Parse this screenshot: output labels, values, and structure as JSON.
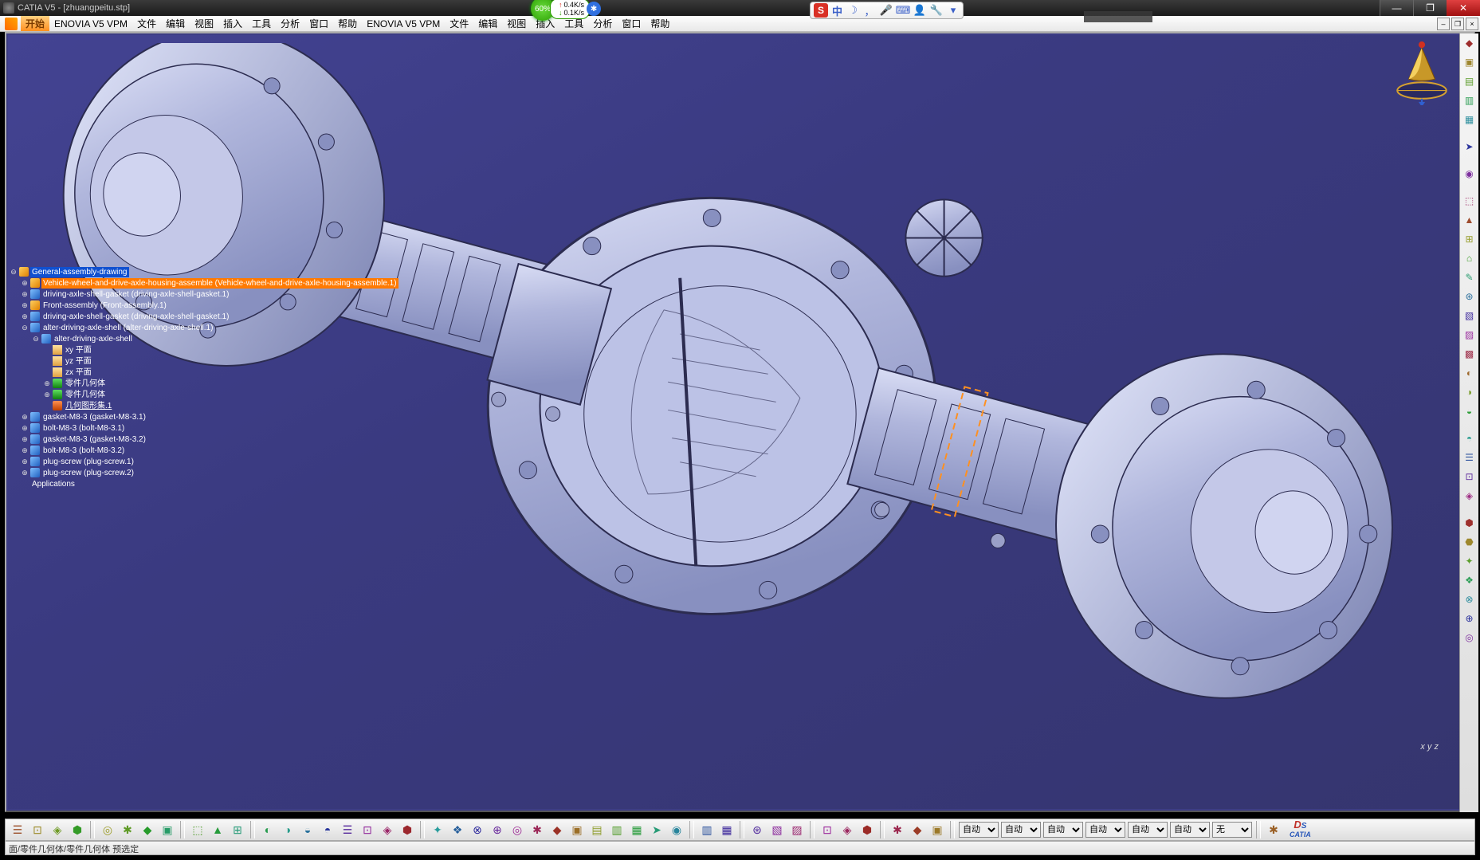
{
  "window": {
    "title": "CATIA V5 - [zhuangpeitu.stp]"
  },
  "menu": {
    "start": "开始",
    "items": [
      "ENOVIA V5 VPM",
      "文件",
      "编辑",
      "视图",
      "插入",
      "工具",
      "分析",
      "窗口",
      "帮助"
    ]
  },
  "overlay": {
    "percent": "60%",
    "up_speed": "0.4K/s",
    "down_speed": "0.1K/s"
  },
  "ime": {
    "logo": "S",
    "mode": "中",
    "icons": [
      "moon",
      "comma",
      "mic",
      "keyboard",
      "person",
      "wrench",
      "gear"
    ]
  },
  "tree": [
    {
      "depth": 0,
      "exp": "-",
      "ico": "assy",
      "label": "General-assembly-drawing",
      "sel": "blue"
    },
    {
      "depth": 1,
      "exp": "+",
      "ico": "assy",
      "label": "Vehicle-wheel-and-drive-axle-housing-assemble (Vehicle-wheel-and-drive-axle-housing-assemble.1)",
      "sel": "orange"
    },
    {
      "depth": 1,
      "exp": "+",
      "ico": "part",
      "label": "driving-axle-shell-gasket (driving-axle-shell-gasket.1)"
    },
    {
      "depth": 1,
      "exp": "+",
      "ico": "assy",
      "label": "Front-assembly (Front-assembly.1)"
    },
    {
      "depth": 1,
      "exp": "+",
      "ico": "part",
      "label": "driving-axle-shell-gasket (driving-axle-shell-gasket.1)"
    },
    {
      "depth": 1,
      "exp": "-",
      "ico": "part",
      "label": "alter-driving-axle-shell (alter-driving-axle-shell.1)"
    },
    {
      "depth": 2,
      "exp": "-",
      "ico": "part",
      "label": "alter-driving-axle-shell"
    },
    {
      "depth": 3,
      "exp": "",
      "ico": "plane",
      "label": "xy 平面"
    },
    {
      "depth": 3,
      "exp": "",
      "ico": "plane",
      "label": "yz 平面"
    },
    {
      "depth": 3,
      "exp": "",
      "ico": "plane",
      "label": "zx 平面"
    },
    {
      "depth": 3,
      "exp": "+",
      "ico": "body",
      "label": "零件几何体"
    },
    {
      "depth": 3,
      "exp": "+",
      "ico": "body",
      "label": "零件几何体"
    },
    {
      "depth": 3,
      "exp": "",
      "ico": "cons",
      "label": "几何图形集.1",
      "ul": true
    },
    {
      "depth": 1,
      "exp": "+",
      "ico": "part",
      "label": "gasket-M8-3 (gasket-M8-3.1)"
    },
    {
      "depth": 1,
      "exp": "+",
      "ico": "part",
      "label": "bolt-M8-3 (bolt-M8-3.1)"
    },
    {
      "depth": 1,
      "exp": "+",
      "ico": "part",
      "label": "gasket-M8-3 (gasket-M8-3.2)"
    },
    {
      "depth": 1,
      "exp": "+",
      "ico": "part",
      "label": "bolt-M8-3 (bolt-M8-3.2)"
    },
    {
      "depth": 1,
      "exp": "+",
      "ico": "part",
      "label": "plug-screw (plug-screw.1)"
    },
    {
      "depth": 1,
      "exp": "+",
      "ico": "part",
      "label": "plug-screw (plug-screw.2)"
    },
    {
      "depth": 0,
      "exp": "",
      "ico": "",
      "label": "Applications"
    }
  ],
  "right_toolbar_groups": [
    [
      "tool1",
      "tool2",
      "tool3",
      "tool4",
      "tool5"
    ],
    [
      "arrow"
    ],
    [
      "tool6"
    ],
    [
      "tool7",
      "tool8",
      "tool9",
      "tool10",
      "tool11",
      "tool12",
      "tool13",
      "tool14",
      "tool15",
      "tool16",
      "tool17",
      "tool18"
    ],
    [
      "tool19",
      "tool20",
      "tool21",
      "tool22"
    ],
    [
      "tool23",
      "tool24",
      "tool25",
      "tool26",
      "tool27",
      "tool28",
      "tool29"
    ]
  ],
  "bottom_toolbar": {
    "icons_left": [
      "new",
      "open",
      "save",
      "saveall",
      "print",
      "cut",
      "copy",
      "paste",
      "undo",
      "redo",
      "help",
      "arrow",
      "fx",
      "calc",
      "sheet",
      "material",
      "exit",
      "exit2",
      "catalog"
    ],
    "icons_mid": [
      "compass",
      "fit",
      "rotate",
      "zoom",
      "zoomarea",
      "zoomin",
      "pan",
      "view-iso",
      "view-multi",
      "hide",
      "swap",
      "prop",
      "swap2"
    ],
    "icons_mid2": [
      "print2",
      "capture"
    ],
    "icons_axis": [
      "axis",
      "axis2",
      "axis3"
    ],
    "icons_tree": [
      "tree1",
      "tree2",
      "tree3"
    ],
    "icons_color": [
      "c1",
      "c2",
      "c3"
    ],
    "selects": [
      "自动",
      "自动",
      "自动",
      "自动",
      "自动",
      "自动",
      "无"
    ],
    "icons_end": [
      "pencil"
    ]
  },
  "statusbar": {
    "text": "面/零件几何体/零件几何体 预选定"
  },
  "viewport": {
    "axis_label": "x y z"
  },
  "colors": {
    "viewport_bg": "#3a3a80",
    "model_fill": "#b8bde0",
    "model_edge": "#2c2c50",
    "highlight_dash": "#ff9020"
  }
}
